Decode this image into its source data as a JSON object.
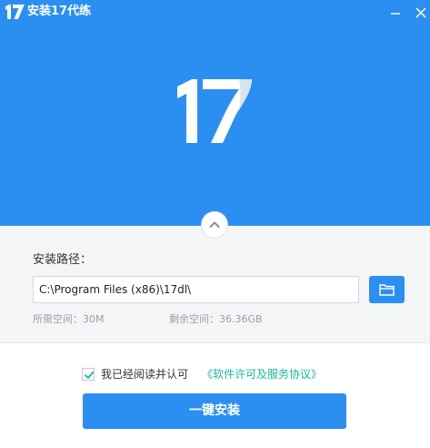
{
  "window": {
    "title": "安装17代练",
    "min_icon": "minimize-icon",
    "close_icon": "close-icon"
  },
  "hero": {
    "logo_icon": "logo-17"
  },
  "install_path": {
    "label": "安装路径：",
    "value": "C:\\Program Files (x86)\\17dl\\",
    "browse_icon": "folder-icon",
    "space_required": "所需空间：30M",
    "space_free": "剩余空间：36.36GB"
  },
  "agreement": {
    "checked": true,
    "text": "我已经阅读并认可",
    "link": "《软件许可及服务协议》"
  },
  "install_button": {
    "label": "一键安装"
  },
  "colors": {
    "primary": "#2b8ff2",
    "link": "#17b89a",
    "panel_bg": "#f4f5f7"
  }
}
